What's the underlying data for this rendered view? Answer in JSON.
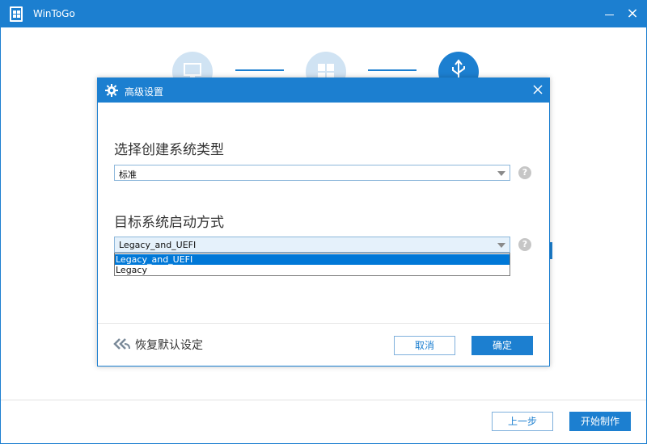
{
  "window": {
    "title": "WinToGo"
  },
  "steps": {
    "icons": [
      "monitor-icon",
      "windows-logo-icon",
      "usb-icon"
    ],
    "active_index": 2
  },
  "footer": {
    "prev_label": "上一步",
    "start_label": "开始制作"
  },
  "dialog": {
    "title": "高级设置",
    "system_type": {
      "label": "选择创建系统类型",
      "selected": "标准"
    },
    "boot_mode": {
      "label": "目标系统启动方式",
      "selected": "Legacy_and_UEFI",
      "options": [
        "Legacy_and_UEFI",
        "Legacy"
      ],
      "highlighted_index": 0
    },
    "help_glyph": "?",
    "restore_label": "恢复默认设定",
    "cancel_label": "取消",
    "ok_label": "确定"
  },
  "colors": {
    "accent": "#1c7fd0",
    "selection": "#0078d7",
    "help": "#c6c6c6"
  }
}
